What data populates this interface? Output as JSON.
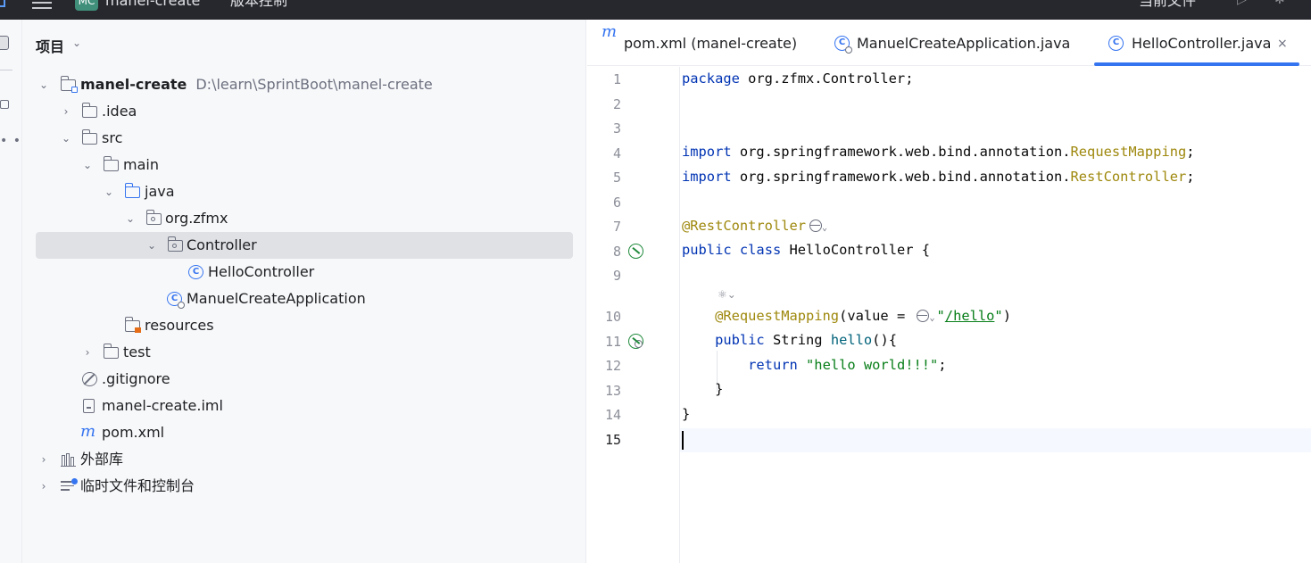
{
  "titlebar": {
    "project_badge": "MC",
    "project_name": "manel-create",
    "vcs_label": "版本控制",
    "run_config": "当前文件"
  },
  "project_panel": {
    "title": "项目",
    "tree": [
      {
        "label": "manel-create",
        "path": "D:\\learn\\SprintBoot\\manel-create",
        "icon": "module-folder-icon",
        "expanded": true
      },
      {
        "label": ".idea",
        "icon": "folder-icon",
        "expanded": false
      },
      {
        "label": "src",
        "icon": "folder-icon",
        "expanded": true
      },
      {
        "label": "main",
        "icon": "folder-icon",
        "expanded": true
      },
      {
        "label": "java",
        "icon": "source-folder-icon",
        "expanded": true
      },
      {
        "label": "org.zfmx",
        "icon": "package-icon",
        "expanded": true
      },
      {
        "label": "Controller",
        "icon": "package-icon",
        "expanded": true,
        "selected": true
      },
      {
        "label": "HelloController",
        "icon": "class-icon"
      },
      {
        "label": "ManuelCreateApplication",
        "icon": "spring-boot-class-icon"
      },
      {
        "label": "resources",
        "icon": "resources-folder-icon"
      },
      {
        "label": "test",
        "icon": "folder-icon",
        "expanded": false
      },
      {
        "label": ".gitignore",
        "icon": "ignore-file-icon"
      },
      {
        "label": "manel-create.iml",
        "icon": "iml-file-icon"
      },
      {
        "label": "pom.xml",
        "icon": "maven-icon"
      },
      {
        "label": "外部库",
        "icon": "library-icon",
        "expanded": false
      },
      {
        "label": "临时文件和控制台",
        "icon": "scratch-icon",
        "expanded": false
      }
    ]
  },
  "editor": {
    "tabs": [
      {
        "label": "pom.xml (manel-create)",
        "icon": "maven-icon"
      },
      {
        "label": "ManuelCreateApplication.java",
        "icon": "spring-boot-class-icon"
      },
      {
        "label": "HelloController.java",
        "icon": "class-icon",
        "active": true,
        "close": "×"
      }
    ],
    "line_numbers": [
      "1",
      "2",
      "3",
      "4",
      "5",
      "6",
      "7",
      "8",
      "9",
      "10",
      "11",
      "12",
      "13",
      "14",
      "15"
    ],
    "code": {
      "l1_kw": "package",
      "l1_rest": " org.zfmx.Controller;",
      "l4_kw": "import",
      "l4_pkg": " org.springframework.web.bind.annotation.",
      "l4_cls": "RequestMapping",
      "l4_end": ";",
      "l5_kw": "import",
      "l5_pkg": " org.springframework.web.bind.annotation.",
      "l5_cls": "RestController",
      "l5_end": ";",
      "l7_ann": "@RestController",
      "l8_kw1": "public",
      "l8_kw2": "class",
      "l8_rest": " HelloController {",
      "l10_ann": "@RequestMapping",
      "l10_open": "(value = ",
      "l10_quote1": "\"",
      "l10_url": "/hello",
      "l10_quote2": "\"",
      "l10_close": ")",
      "l11_kw": "public",
      "l11_type": " String ",
      "l11_fn": "hello",
      "l11_rest": "(){",
      "l12_kw": "return",
      "l12_str": "\"hello world!!!\"",
      "l12_end": ";",
      "l13": "}",
      "l14": "}"
    }
  },
  "colors": {
    "keyword": "#0033b3",
    "annotation": "#9e880d",
    "string": "#067d17",
    "function": "#00627a",
    "accent": "#3574f0"
  }
}
